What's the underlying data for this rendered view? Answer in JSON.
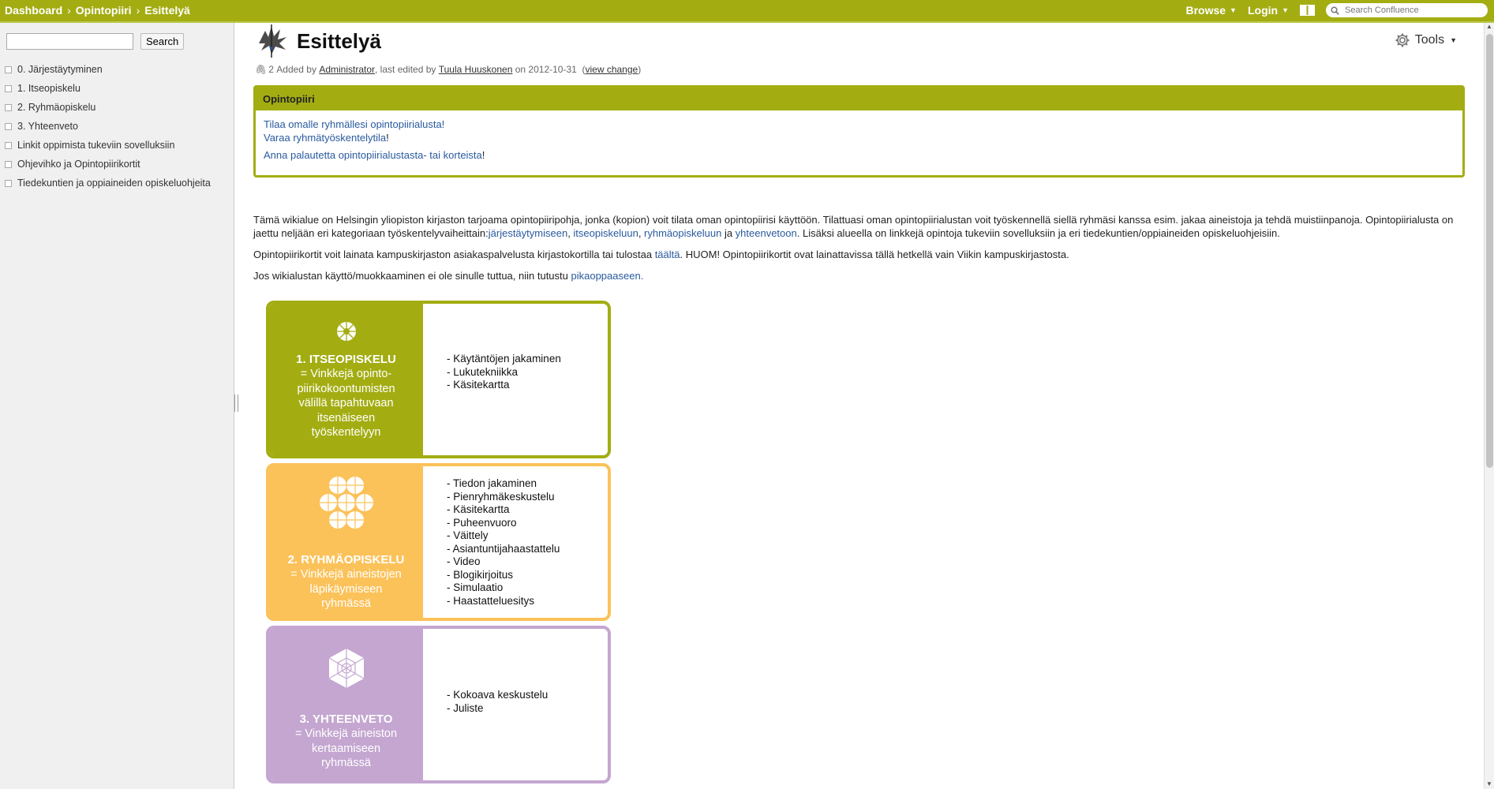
{
  "topbar": {
    "breadcrumbs": [
      "Dashboard",
      "Opintopiiri",
      "Esittelyä"
    ],
    "separator": "›",
    "browse_label": "Browse",
    "login_label": "Login",
    "search_placeholder": "Search Confluence",
    "color": "#a3ad12"
  },
  "sidebar": {
    "search_button": "Search",
    "items": [
      {
        "label": "0. Järjestäytyminen"
      },
      {
        "label": "1. Itseopiskelu"
      },
      {
        "label": "2. Ryhmäopiskelu"
      },
      {
        "label": "3. Yhteenveto"
      },
      {
        "label": "Linkit oppimista tukeviin sovelluksiin"
      },
      {
        "label": "Ohjevihko ja Opintopiirikortit"
      },
      {
        "label": "Tiedekuntien ja oppiaineiden opiskeluohjeita"
      }
    ]
  },
  "page": {
    "title": "Esittelyä",
    "tools_label": "Tools",
    "meta": {
      "attachments": "2",
      "added_by_prefix": "Added by",
      "added_by": "Administrator",
      "edited_prefix": ", last edited by",
      "edited_by": "Tuula Huuskonen",
      "date_prefix": "on",
      "date": "2012-10-31",
      "view_change": "view change"
    },
    "panel": {
      "title": "Opintopiiri",
      "link1": "Tilaa omalle ryhmällesi opintopiirialusta!",
      "link2": "Varaa ryhmätyöskentelytila",
      "link2_suffix": "!",
      "link3": "Anna palautetta opintopiirialustasta- tai korteista",
      "link3_suffix": "!"
    },
    "para1": {
      "text": "Tämä wikialue on Helsingin yliopiston kirjaston tarjoama opintopiiripohja, jonka (kopion) voit tilata oman opintopiirisi käyttöön. Tilattuasi oman opintopiirialustan voit työskennellä siellä ryhmäsi kanssa esim. jakaa aineistoja ja tehdä muistiinpanoja. Opintopiirialusta on jaettu neljään eri kategoriaan työskentelyvaiheittain:",
      "link1": "järjestäytymiseen",
      "sep1": ", ",
      "link2": "itseopiskeluun",
      "sep2": ", ",
      "link3": "ryhmäopiskeluun",
      "sep3": " ja ",
      "link4": "yhteenvetoon",
      "tail": ". Lisäksi alueella on linkkejä opintoja tukeviin sovelluksiin ja eri tiedekuntien/oppiaineiden opiskeluohjeisiin."
    },
    "para2": {
      "text": "Opintopiirikortit voit lainata kampuskirjaston asiakaspalvelusta kirjastokortilla tai tulostaa ",
      "link": "täältä",
      "tail": ". HUOM! Opintopiirikortit ovat lainattavissa tällä hetkellä vain Viikin kampuskirjastosta."
    },
    "para3": {
      "text": "Jos wikialustan käyttö/muokkaaminen ei ole sinulle tuttua, niin tutustu ",
      "link": "pikaoppaaseen."
    }
  },
  "cards": [
    {
      "title": "1. ITSEOPISKELU",
      "desc": [
        "= Vinkkejä opinto-",
        "piirikokoontumisten",
        "välillä tapahtuvaan",
        "itsenäiseen",
        "työskentelyyn"
      ],
      "items": [
        "- Käytäntöjen jakaminen",
        "- Lukutekniikka",
        "- Käsitekartta"
      ],
      "color": "#a3ad12",
      "icon": "single-flower-icon"
    },
    {
      "title": "2. RYHMÄOPISKELU",
      "desc": [
        "= Vinkkejä aineistojen",
        "läpikäymiseen",
        "ryhmässä"
      ],
      "items": [
        "- Tiedon jakaminen",
        "- Pienryhmäkeskustelu",
        "- Käsitekartta",
        "- Puheenvuoro",
        "- Väittely",
        "- Asiantuntijahaastattelu",
        "- Video",
        "- Blogikirjoitus",
        "- Simulaatio",
        "- Haastatteluesitys"
      ],
      "color": "#fbc25a",
      "icon": "flower-cluster-icon"
    },
    {
      "title": "3. YHTEENVETO",
      "desc": [
        "= Vinkkejä aineiston",
        "kertaamiseen",
        "ryhmässä"
      ],
      "items": [
        "- Kokoava keskustelu",
        "- Juliste"
      ],
      "color": "#c4a6d0",
      "icon": "hexagon-flower-icon"
    }
  ]
}
